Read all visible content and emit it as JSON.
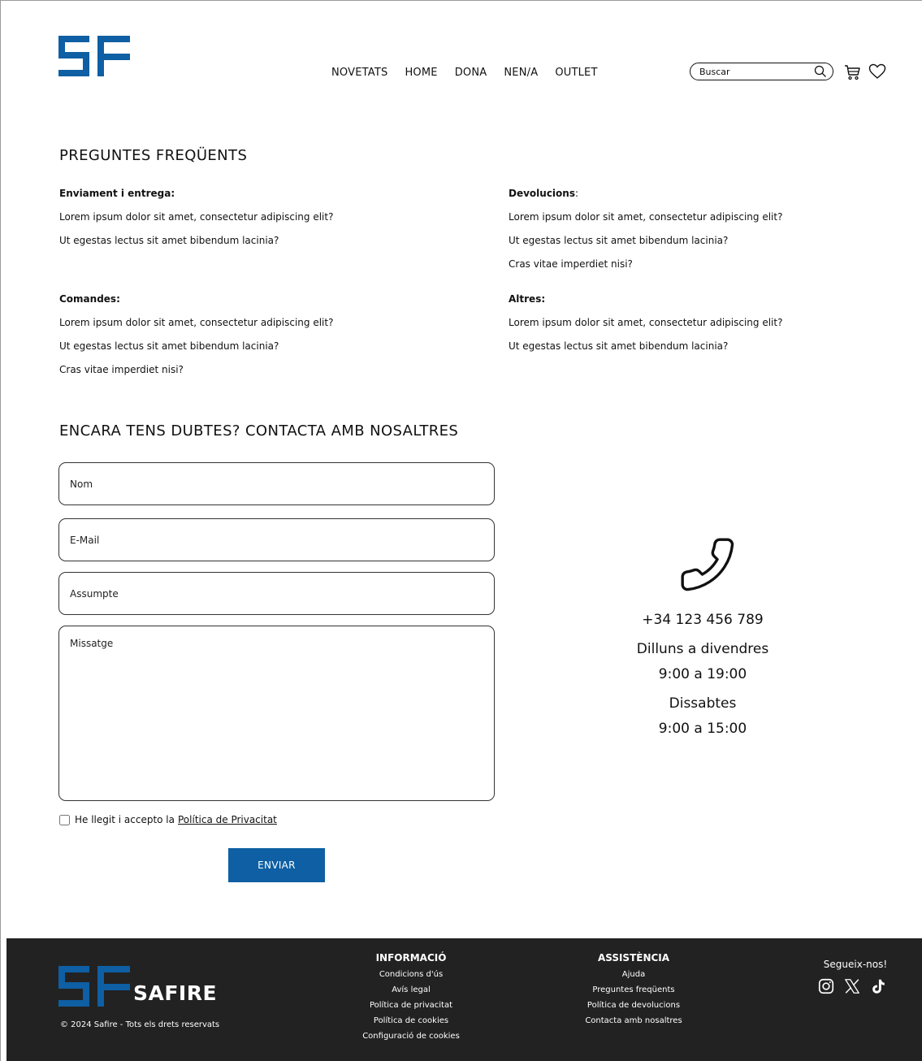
{
  "colors": {
    "brand_blue": "#0e5fa3",
    "footer_bg": "#222222",
    "text": "#111111"
  },
  "header": {
    "nav": [
      "NOVETATS",
      "HOME",
      "DONA",
      "NEN/A",
      "OUTLET"
    ],
    "search_placeholder": "Buscar",
    "icons": [
      "search-icon",
      "cart-icon",
      "heart-icon"
    ]
  },
  "faq": {
    "title": "PREGUNTES FREQÜENTS",
    "sections": [
      {
        "title": "Enviament i entrega:",
        "items": [
          "Lorem ipsum dolor sit amet, consectetur adipiscing elit?",
          "Ut egestas lectus sit amet bibendum lacinia?"
        ]
      },
      {
        "title": "Devolucions",
        "suffix": ":",
        "items": [
          "Lorem ipsum dolor sit amet, consectetur adipiscing elit?",
          "Ut egestas lectus sit amet bibendum lacinia?",
          "Cras vitae imperdiet nisi?"
        ]
      },
      {
        "title": "Comandes:",
        "items": [
          "Lorem ipsum dolor sit amet, consectetur adipiscing elit?",
          "Ut egestas lectus sit amet bibendum lacinia?",
          "Cras vitae imperdiet nisi?"
        ]
      },
      {
        "title": "Altres:",
        "items": [
          "Lorem ipsum dolor sit amet, consectetur adipiscing elit?",
          "Ut egestas lectus sit amet bibendum lacinia?"
        ]
      }
    ]
  },
  "contact": {
    "title": "ENCARA TENS DUBTES? CONTACTA AMB NOSALTRES",
    "fields": {
      "name": "Nom",
      "email": "E-Mail",
      "subject": "Assumpte",
      "message": "Missatge"
    },
    "consent_text": "He llegit i accepto la",
    "consent_link": "Política de Privacitat",
    "submit": "ENVIAR",
    "phone": "+34 123 456 789",
    "hours": [
      "Dilluns a divendres",
      "9:00 a 19:00",
      "Dissabtes",
      "9:00 a 15:00"
    ]
  },
  "footer": {
    "brand": "SAFIRE",
    "copyright": "© 2024 Safire - Tots els drets reservats",
    "info": {
      "title": "INFORMACIÓ",
      "links": [
        "Condicions d'ús",
        "Avís legal",
        "Política de privacitat",
        "Política de cookies",
        "Configuració de cookies"
      ]
    },
    "support": {
      "title": "ASSISTÈNCIA",
      "links": [
        "Ajuda",
        "Preguntes freqüents",
        "Política de devolucions",
        "Contacta amb nosaltres"
      ]
    },
    "follow": "Segueix-nos!",
    "social_icons": [
      "instagram-icon",
      "x-icon",
      "tiktok-icon"
    ]
  }
}
